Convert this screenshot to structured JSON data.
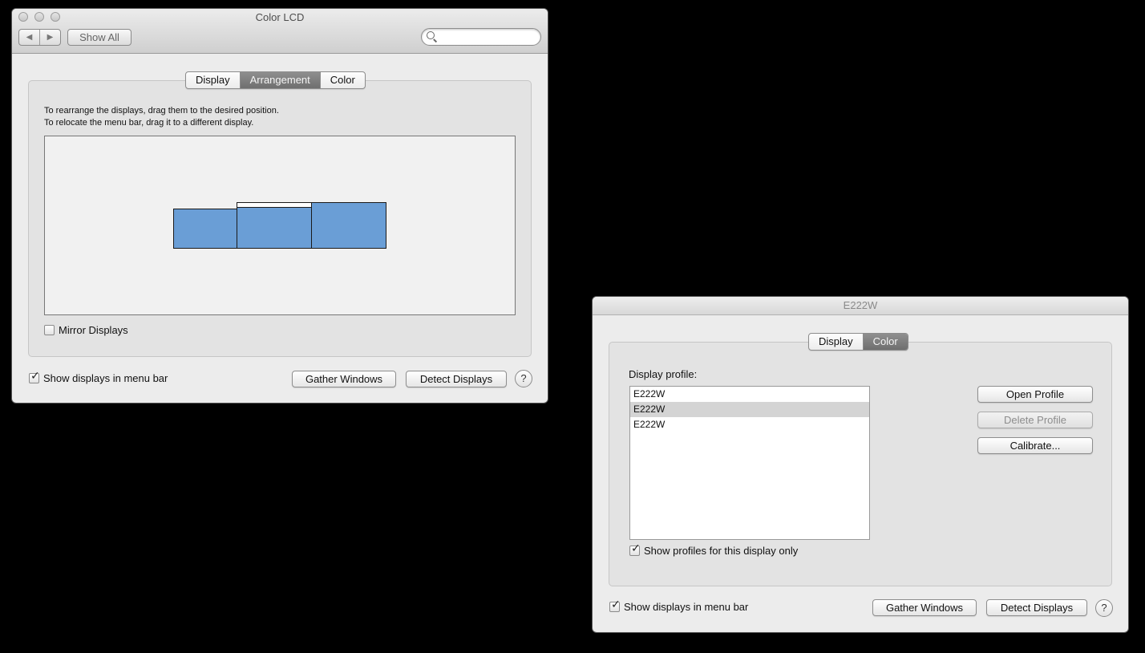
{
  "window1": {
    "title": "Color LCD",
    "nav": {
      "back_glyph": "◀",
      "forward_glyph": "▶"
    },
    "show_all_label": "Show All",
    "search": {
      "value": "",
      "placeholder": ""
    },
    "tabs": [
      {
        "label": "Display",
        "active": false
      },
      {
        "label": "Arrangement",
        "active": true
      },
      {
        "label": "Color",
        "active": false
      }
    ],
    "instructions": {
      "line1": "To rearrange the displays, drag them to the desired position.",
      "line2": "To relocate the menu bar, drag it to a different display."
    },
    "display_color": "#6a9ed6",
    "mirror_displays": {
      "label": "Mirror Displays",
      "checked": false
    },
    "show_in_menu_bar": {
      "label": "Show displays in menu bar",
      "checked": true
    },
    "gather_windows_label": "Gather Windows",
    "detect_displays_label": "Detect Displays",
    "help_label": "?"
  },
  "window2": {
    "title": "E222W",
    "tabs": [
      {
        "label": "Display",
        "active": false
      },
      {
        "label": "Color",
        "active": true
      }
    ],
    "display_profile_label": "Display profile:",
    "profiles": [
      {
        "name": "E222W",
        "selected": false
      },
      {
        "name": "E222W",
        "selected": true
      },
      {
        "name": "E222W",
        "selected": false
      }
    ],
    "open_profile_label": "Open Profile",
    "delete_profile_label": "Delete Profile",
    "calibrate_label": "Calibrate...",
    "show_profiles_only": {
      "label": "Show profiles for this display only",
      "checked": true
    },
    "show_in_menu_bar": {
      "label": "Show displays in menu bar",
      "checked": true
    },
    "gather_windows_label": "Gather Windows",
    "detect_displays_label": "Detect Displays",
    "help_label": "?"
  }
}
